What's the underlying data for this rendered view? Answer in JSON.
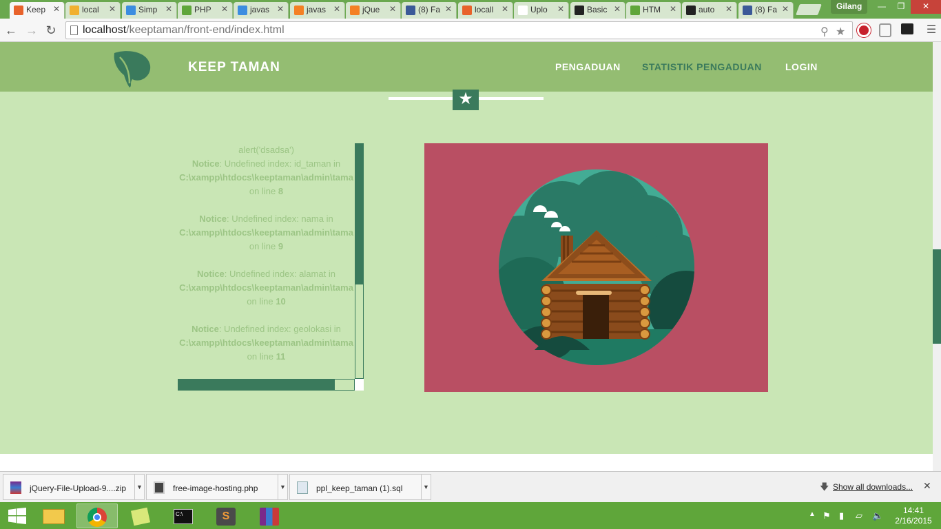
{
  "browser": {
    "tabs": [
      {
        "label": "Keep",
        "icon": "xampp-icon",
        "color": "#e8622b"
      },
      {
        "label": "local",
        "icon": "phpmyadmin-icon",
        "color": "#f0b030"
      },
      {
        "label": "Simp",
        "icon": "google-drive-icon",
        "color": "#3c8de0"
      },
      {
        "label": "PHP",
        "icon": "w3schools-icon",
        "color": "#5fa63a"
      },
      {
        "label": "javas",
        "icon": "loading-icon",
        "color": "#3c8de0"
      },
      {
        "label": "javas",
        "icon": "stackoverflow-icon",
        "color": "#f48024"
      },
      {
        "label": "jQue",
        "icon": "stackoverflow-icon",
        "color": "#f48024"
      },
      {
        "label": "(8) Fa",
        "icon": "facebook-icon",
        "color": "#3b5998"
      },
      {
        "label": "locall",
        "icon": "xampp-icon",
        "color": "#e8622b"
      },
      {
        "label": "Uplo",
        "icon": "page-icon",
        "color": "#ffffff"
      },
      {
        "label": "Basic",
        "icon": "github-icon",
        "color": "#222222"
      },
      {
        "label": "HTM",
        "icon": "w3schools-icon",
        "color": "#5fa63a"
      },
      {
        "label": "auto",
        "icon": "github-icon",
        "color": "#222222"
      },
      {
        "label": "(8) Fa",
        "icon": "facebook-icon",
        "color": "#3b5998"
      }
    ],
    "profile_name": "Gilang",
    "url_host": "localhost",
    "url_path": "/keeptaman/front-end/index.html"
  },
  "site": {
    "brand": "KEEP TAMAN",
    "nav": [
      "PENGADUAN",
      "STATISTIK PENGADUAN",
      "LOGIN"
    ],
    "active_nav": "STATISTIK PENGADUAN",
    "accent_color": "#3a7a5c",
    "header_color": "#94bd72",
    "background_color": "#c9e6b5",
    "card_color": "#b94f63"
  },
  "notices": {
    "alert_line": "alert('dsadsa')",
    "items": [
      {
        "prefix": "Notice",
        "message": ": Undefined index: id_taman in",
        "path": "C:\\xampp\\htdocs\\keeptaman\\admin\\tama",
        "line_label": "on line",
        "line": "8"
      },
      {
        "prefix": "Notice",
        "message": ": Undefined index: nama in",
        "path": "C:\\xampp\\htdocs\\keeptaman\\admin\\tama",
        "line_label": "on line",
        "line": "9"
      },
      {
        "prefix": "Notice",
        "message": ": Undefined index: alamat in",
        "path": "C:\\xampp\\htdocs\\keeptaman\\admin\\tama",
        "line_label": "on line",
        "line": "10"
      },
      {
        "prefix": "Notice",
        "message": ": Undefined index: geolokasi in",
        "path": "C:\\xampp\\htdocs\\keeptaman\\admin\\tama",
        "line_label": "on line",
        "line": "11"
      }
    ]
  },
  "downloads": {
    "items": [
      {
        "name": "jQuery-File-Upload-9....zip",
        "icon": "winrar-icon"
      },
      {
        "name": "free-image-hosting.php",
        "icon": "php-file-icon"
      },
      {
        "name": "ppl_keep_taman (1).sql",
        "icon": "sql-file-icon"
      }
    ],
    "show_all": "Show all downloads..."
  },
  "taskbar": {
    "apps": [
      "file-explorer-icon",
      "chrome-icon",
      "sticky-notes-icon",
      "cmd-icon",
      "sublime-text-icon",
      "winrar-icon"
    ],
    "active_app": "chrome-icon",
    "time": "14:41",
    "date": "2/16/2015"
  }
}
